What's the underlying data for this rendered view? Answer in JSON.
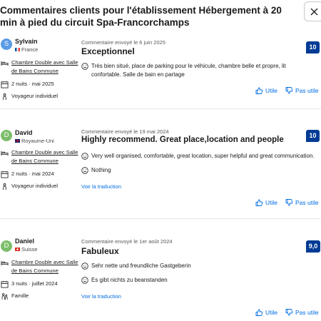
{
  "header": {
    "title": "Commentaires clients pour l'établissement Hébergement à 20 min à pied du circuit Spa-Francorchamps"
  },
  "labels": {
    "helpful": "Utile",
    "not_helpful": "Pas utile",
    "translate": "Voir la traduction"
  },
  "colors": {
    "score_bg": "#003b95",
    "link": "#006ce4",
    "avatar_s": "#5a9be6",
    "avatar_d": "#7cbd6a"
  },
  "reviews": [
    {
      "initial": "S",
      "name": "Sylvain",
      "country": "France",
      "room": [
        "Chambre Double avec Salle",
        "de Bains Commune"
      ],
      "stay": "2 nuits · mai 2025",
      "traveler": "Voyageur individuel",
      "sent": "Commentaire envoyé le 6 juin 2025",
      "title": "Exceptionnel",
      "score": "10",
      "positive": "Très bien situé, place de parking pour le véhicule, chambre belle et propre, lit confortable. Salle de bain en partage"
    },
    {
      "initial": "D",
      "name": "David",
      "country": "Royaume-Uni",
      "room": [
        "Chambre Double avec Salle",
        "de Bains Commune"
      ],
      "stay": "2 nuits · mai 2024",
      "traveler": "Voyageur individuel",
      "sent": "Commentaire envoyé le 19 mai 2024",
      "title": "Highly recommend. Great place,location and people",
      "score": "10",
      "positive": "Very well organised, comfortable, great location, super helpful and great communication.",
      "negative": "Nothing"
    },
    {
      "initial": "D",
      "name": "Daniel",
      "country": "Suisse",
      "room": [
        "Chambre Double avec Salle",
        "de Bains Commune"
      ],
      "stay": "3 nuits · juillet 2024",
      "traveler": "Famille",
      "sent": "Commentaire envoyé le 1er août 2024",
      "title": "Fabuleux",
      "score": "9,0",
      "positive": "Sehr nette und freundliche Gastgeberin",
      "negative": "Es gibt nichts zu beanstanden"
    }
  ]
}
